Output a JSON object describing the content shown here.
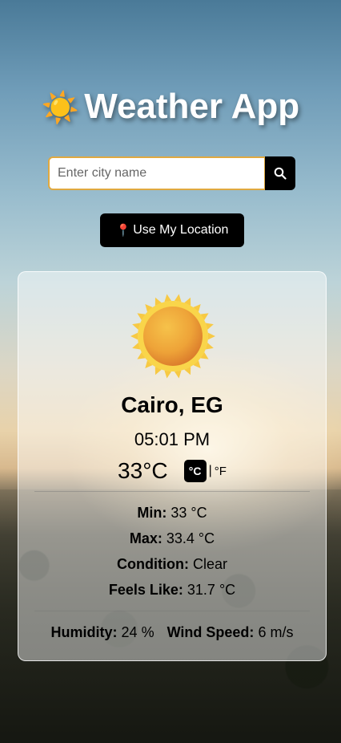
{
  "app": {
    "title": "Weather App",
    "title_icon": "☀️"
  },
  "search": {
    "placeholder": "Enter city name",
    "value": ""
  },
  "location_button": {
    "icon": "📍",
    "label": "Use My Location"
  },
  "weather": {
    "icon_name": "sun-icon",
    "city": "Cairo, EG",
    "time": "05:01 PM",
    "temperature": "33°C",
    "unit_celsius": "°C",
    "unit_separator": "|",
    "unit_fahrenheit": "°F",
    "min_label": "Min:",
    "min_value": "33 °C",
    "max_label": "Max:",
    "max_value": "33.4 °C",
    "condition_label": "Condition:",
    "condition_value": "Clear",
    "feels_label": "Feels Like:",
    "feels_value": "31.7 °C",
    "humidity_label": "Humidity:",
    "humidity_value": "24 %",
    "wind_label": "Wind Speed:",
    "wind_value": "6 m/s"
  },
  "colors": {
    "accent_border": "#e0a940",
    "button_bg": "#000000",
    "sun_core": "#f0a830"
  }
}
